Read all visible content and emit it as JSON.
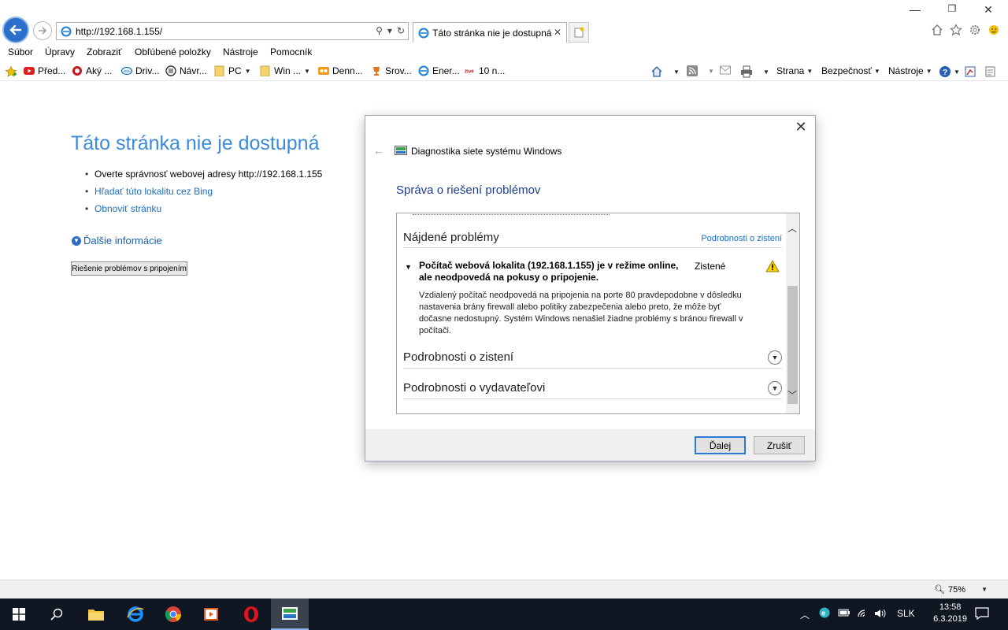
{
  "browser": {
    "url": "http://192.168.1.155/",
    "tab_title": "Táto stránka nie je dostupná",
    "menu": [
      "Súbor",
      "Úpravy",
      "Zobraziť",
      "Obľúbené položky",
      "Nástroje",
      "Pomocník"
    ],
    "favorites": [
      {
        "label": "Před...",
        "icon": "youtube-icon"
      },
      {
        "label": "Aký ...",
        "icon": "red-ring-icon"
      },
      {
        "label": "Driv...",
        "icon": "intel-icon"
      },
      {
        "label": "Návr...",
        "icon": "dial-icon"
      },
      {
        "label": "PC",
        "icon": "folder-icon"
      },
      {
        "label": "Win ...",
        "icon": "folder-icon"
      },
      {
        "label": "Denn...",
        "icon": "face-icon"
      },
      {
        "label": "Srov...",
        "icon": "cup-icon"
      },
      {
        "label": "Ener...",
        "icon": "ie-icon"
      },
      {
        "label": "10 n...",
        "icon": "zive-icon"
      }
    ],
    "commands": {
      "page": "Strana",
      "safety": "Bezpečnosť",
      "tools": "Nástroje"
    },
    "zoom": "75%"
  },
  "page": {
    "title": "Táto stránka nie je dostupná",
    "bullets": [
      "Overte správnosť webovej adresy http://192.168.1.155",
      "Hľadať túto lokalitu cez Bing",
      "Obnoviť stránku"
    ],
    "more_info": "Ďalšie informácie",
    "troubleshoot_button": "Riešenie problémov s pripojením"
  },
  "dialog": {
    "app_title": "Diagnostika siete systému Windows",
    "heading": "Správa o riešení problémov",
    "found_title": "Nájdené problémy",
    "found_link": "Podrobnosti o zistení",
    "problem_title": "Počítač webová lokalita (192.168.1.155) je v režime online, ale neodpovedá na pokusy o pripojenie.",
    "problem_status": "Zistené",
    "problem_desc": "Vzdialený počítač neodpovedá na pripojenia na porte 80 pravdepodobne v dôsledku nastavenia brány firewall alebo politiky zabezpečenia alebo preto, že môže byť dočasne nedostupný. Systém Windows nenašiel žiadne problémy s bránou firewall v počítači.",
    "detection_details": "Podrobnosti o zistení",
    "publisher_details": "Podrobnosti o vydavateľovi",
    "next_button": "Ďalej",
    "cancel_button": "Zrušiť"
  },
  "taskbar": {
    "language": "SLK",
    "time": "13:58",
    "date": "6.3.2019"
  },
  "colors": {
    "link": "#1a6fc4",
    "error_title": "#3b8bd8",
    "dialog_heading": "#1c3f94",
    "taskbar": "#101722"
  }
}
